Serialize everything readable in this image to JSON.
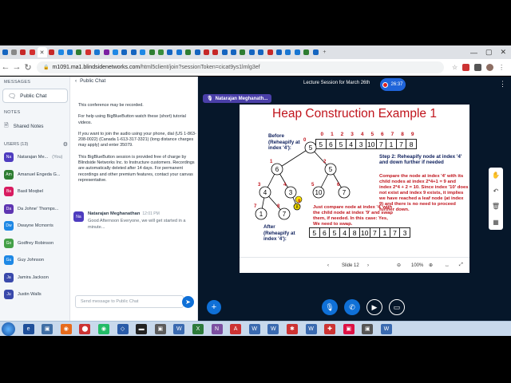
{
  "browser": {
    "tabs": [
      {
        "color": "#1565c0",
        "glyph": "▣"
      },
      {
        "color": "#888",
        "glyph": "⚙"
      },
      {
        "color": "#c62828",
        "glyph": "M"
      },
      {
        "color": "#d32f2f",
        "glyph": "◯"
      },
      {
        "color": "#fff",
        "glyph": "✕",
        "active": true
      },
      {
        "color": "#c62828",
        "glyph": "G"
      },
      {
        "color": "#1e88e5",
        "glyph": "W"
      },
      {
        "color": "#1976d2",
        "glyph": "W"
      },
      {
        "color": "#2e7d32",
        "glyph": "▣"
      },
      {
        "color": "#d32f2f",
        "glyph": "◯"
      },
      {
        "color": "#1976d2",
        "glyph": "W"
      },
      {
        "color": "#7b1fa2",
        "glyph": "▣"
      },
      {
        "color": "#1e88e5",
        "glyph": "▣"
      },
      {
        "color": "#1565c0",
        "glyph": "W"
      },
      {
        "color": "#1565c0",
        "glyph": "W"
      },
      {
        "color": "#1e88e5",
        "glyph": "▣"
      },
      {
        "color": "#2e7d32",
        "glyph": "▣"
      },
      {
        "color": "#388e3c",
        "glyph": "V"
      },
      {
        "color": "#1565c0",
        "glyph": "W"
      },
      {
        "color": "#1976d2",
        "glyph": "W"
      },
      {
        "color": "#2e7d32",
        "glyph": "▣"
      },
      {
        "color": "#1565c0",
        "glyph": "B"
      },
      {
        "color": "#c62828",
        "glyph": "◯"
      },
      {
        "color": "#c62828",
        "glyph": "▣"
      },
      {
        "color": "#1565c0",
        "glyph": "▣"
      },
      {
        "color": "#1565c0",
        "glyph": "▣"
      },
      {
        "color": "#2e7d32",
        "glyph": "▣"
      },
      {
        "color": "#1565c0",
        "glyph": "W"
      },
      {
        "color": "#1565c0",
        "glyph": "▣"
      },
      {
        "color": "#c62828",
        "glyph": "▣"
      },
      {
        "color": "#1565c0",
        "glyph": "▣"
      },
      {
        "color": "#1976d2",
        "glyph": "▣"
      },
      {
        "color": "#1976d2",
        "glyph": "▣"
      },
      {
        "color": "#2e7d32",
        "glyph": "▣"
      },
      {
        "color": "#1565c0",
        "glyph": "▣"
      }
    ],
    "new_tab": "+",
    "win_min": "—",
    "win_max": "▢",
    "win_close": "✕",
    "url_prefix": "m1091.ma1.blindsidenetworks.com",
    "url_rest": "/html5client/join?sessionToken=cicat9ys1lmlg3ef"
  },
  "sidebar": {
    "messages_title": "MESSAGES",
    "public_chat": "Public Chat",
    "notes_title": "NOTES",
    "shared_notes": "Shared Notes",
    "users_title": "USERS (13)",
    "users": [
      {
        "initials": "Na",
        "name": "Natarajan Me...",
        "suffix": "(You)",
        "color": "#4e3cbf"
      },
      {
        "initials": "Am",
        "name": "Amanuel Engeda G...",
        "color": "#2e7d32"
      },
      {
        "initials": "Ba",
        "name": "Basil Moqbel",
        "color": "#d81b60"
      },
      {
        "initials": "Da",
        "name": "Da Johne' Thomps...",
        "color": "#5e35b1"
      },
      {
        "initials": "Dw",
        "name": "Dwayne Mcmorris",
        "color": "#1e88e5"
      },
      {
        "initials": "Go",
        "name": "Godfrey Robinson",
        "color": "#43a047"
      },
      {
        "initials": "Gu",
        "name": "Guy Johnson",
        "color": "#1e88e5"
      },
      {
        "initials": "Ja",
        "name": "Jamira Jackson",
        "color": "#3949ab"
      },
      {
        "initials": "Ju",
        "name": "Justin Walls",
        "color": "#3949ab"
      }
    ]
  },
  "chat": {
    "back_label": "Public Chat",
    "welcome": [
      "This conference may be recorded.",
      "For help using BigBlueButton watch these (short) tutorial videos.",
      "If you want to join the audio using your phone, dial (US 1-863-208-0022) (Canada 1-613-317-3321) (long distance charges may apply) and enter 35079.",
      "This BigBlueButton session is provided free of charge by Blindside Networks Inc. to Instructure customers. Recordings are automatically deleted after 14 days. For permanent recordings and other premium features, contact your canvas representative."
    ],
    "message": {
      "initials": "Na",
      "sender": "Natarajan Meghanathan",
      "time": "12:01 PM",
      "text": "Good Afternoon Everyone, we will get started in a minute..."
    },
    "input_placeholder": "Send message to Public Chat"
  },
  "main": {
    "session_title": "Lecture Session for March 26th",
    "timer": "26:37",
    "talking": "Natarajan Meghanath...",
    "minimize": "—"
  },
  "slide": {
    "title": "Heap Construction Example 1",
    "before_label": "Before (Reheapify at index '4'):",
    "after_label": "After (Reheapify at index '4'):",
    "indices": [
      "0",
      "1",
      "2",
      "3",
      "4",
      "5",
      "6",
      "7",
      "8",
      "9"
    ],
    "before_array": [
      "5",
      "6",
      "5",
      "4",
      "3",
      "10",
      "7",
      "1",
      "7",
      "8"
    ],
    "after_array": [
      "5",
      "6",
      "5",
      "4",
      "8",
      "10",
      "7",
      "1",
      "7",
      "3"
    ],
    "step2": "Step 2: Reheapify node at index '4' and down further if needed",
    "explanation": "Compare the node at index '4' with its child nodes at index 2*4+1 = 9 and index 2*4 + 2 = 10. Since index '10' does not exist and index 9 exists, it implies we have reached a leaf node (at index 9) and there is no need to proceed further down.",
    "explanation2": "Just compare node at index '4' with the child node at index '9' and swap them, if needed. In this case: Yes, We need to swap.",
    "tree_nodes": [
      {
        "v": "5",
        "i": "0"
      },
      {
        "v": "6",
        "i": "1"
      },
      {
        "v": "5",
        "i": "2"
      },
      {
        "v": "4",
        "i": "3"
      },
      {
        "v": "3",
        "i": "4"
      },
      {
        "v": "10",
        "i": "5"
      },
      {
        "v": "7",
        "i": "6"
      },
      {
        "v": "1",
        "i": "7"
      },
      {
        "v": "7",
        "i": "8"
      },
      {
        "v": "8",
        "i": "9"
      }
    ]
  },
  "slide_controls": {
    "prev": "‹",
    "page": "Slide 12",
    "next": "›",
    "zoom_out": "⊖",
    "zoom": "100%",
    "zoom_in": "⊕",
    "fit": "↔",
    "fullscreen": "⤢"
  },
  "tools": [
    "✋",
    "↶",
    "🗑",
    "▦"
  ],
  "taskbar": [
    {
      "color": "#1e4f9a",
      "glyph": "e"
    },
    {
      "color": "#3f6ea5",
      "glyph": "▣"
    },
    {
      "color": "#e76b1c",
      "glyph": "◉"
    },
    {
      "color": "#c33",
      "glyph": "⬤"
    },
    {
      "color": "#2b6",
      "glyph": "◉"
    },
    {
      "color": "#2a5ca8",
      "glyph": "◇"
    },
    {
      "color": "#222",
      "glyph": "▬"
    },
    {
      "color": "#5c5c5c",
      "glyph": "▣"
    },
    {
      "color": "#3a6ab0",
      "glyph": "W"
    },
    {
      "color": "#2d7a3a",
      "glyph": "X"
    },
    {
      "color": "#7c4fa0",
      "glyph": "N"
    },
    {
      "color": "#c33",
      "glyph": "A"
    },
    {
      "color": "#3a6ab0",
      "glyph": "W"
    },
    {
      "color": "#3a6ab0",
      "glyph": "W"
    },
    {
      "color": "#c33",
      "glyph": "✱"
    },
    {
      "color": "#3a6ab0",
      "glyph": "W"
    },
    {
      "color": "#c33",
      "glyph": "✚"
    },
    {
      "color": "#d14",
      "glyph": "▣"
    },
    {
      "color": "#555",
      "glyph": "▣"
    },
    {
      "color": "#3a6ab0",
      "glyph": "W"
    }
  ]
}
